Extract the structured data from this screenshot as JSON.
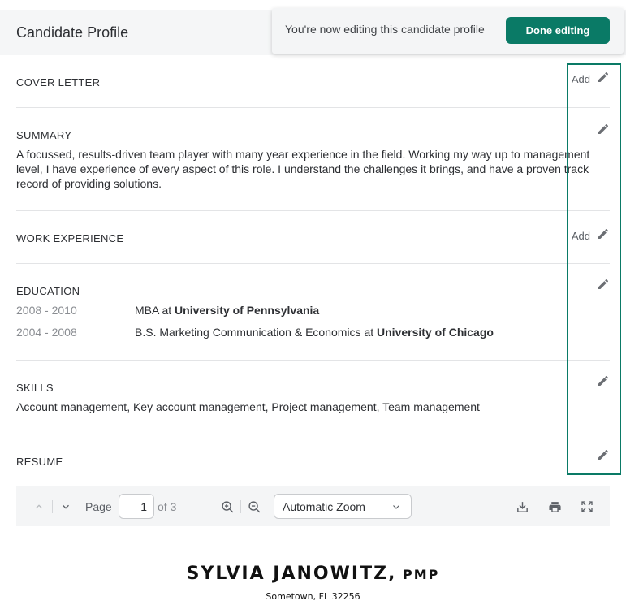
{
  "header": {
    "title": "Candidate Profile"
  },
  "toast": {
    "message": "You're now editing this candidate profile",
    "done_label": "Done editing"
  },
  "sections": {
    "cover_letter": {
      "title": "COVER LETTER",
      "action_label": "Add"
    },
    "summary": {
      "title": "SUMMARY",
      "text": "A focussed, results-driven team player with many year experience in the field. Working my way up to management level, I have experience of every aspect of this role. I understand the challenges it brings, and have a proven track record of providing solutions."
    },
    "work_experience": {
      "title": "WORK EXPERIENCE",
      "action_label": "Add"
    },
    "education": {
      "title": "EDUCATION",
      "entries": [
        {
          "years": "2008 - 2010",
          "degree": "MBA at ",
          "school": "University of Pennsylvania"
        },
        {
          "years": "2004 - 2008",
          "degree": "B.S. Marketing Communication & Economics at ",
          "school": "University of Chicago"
        }
      ]
    },
    "skills": {
      "title": "SKILLS",
      "text": "Account management, Key account management, Project management, Team management"
    },
    "resume": {
      "title": "RESUME"
    }
  },
  "pdf_viewer": {
    "page_label": "Page",
    "current_page": "1",
    "of_label": "of 3",
    "zoom": "Automatic Zoom"
  },
  "document": {
    "name": "SYLVIA JANOWITZ,",
    "credential": "PMP",
    "address": "Sometown, FL 32256"
  },
  "colors": {
    "accent": "#0a7a66",
    "highlight": "#0a7a66"
  },
  "icons": [
    "pencil-icon",
    "chevron-up-icon",
    "chevron-down-icon",
    "zoom-in-icon",
    "zoom-out-icon",
    "download-icon",
    "print-icon",
    "fullscreen-icon"
  ]
}
